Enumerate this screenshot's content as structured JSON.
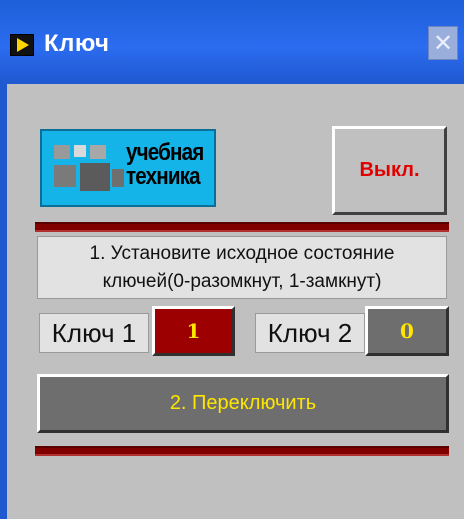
{
  "window": {
    "title": "Ключ",
    "close_glyph": "✕"
  },
  "logo": {
    "text_line1": "учебная",
    "text_line2": "техника"
  },
  "power_button": {
    "label": "Выкл."
  },
  "instruction": {
    "line1": "1. Установите исходное состояние",
    "line2": "ключей(0-разомкнут, 1-замкнут)"
  },
  "keys": [
    {
      "label": "Ключ 1",
      "value": "1",
      "color": "#9c0000"
    },
    {
      "label": "Ключ 2",
      "value": "0",
      "color": "#6e6e6e"
    }
  ],
  "switch_button": {
    "label": "2. Переключить"
  },
  "colors": {
    "titlebar": "#2b6cf0",
    "panel": "#c0c0c0",
    "separator": "#800000",
    "accent_text": "#ffe600",
    "off_text": "#e00000"
  }
}
